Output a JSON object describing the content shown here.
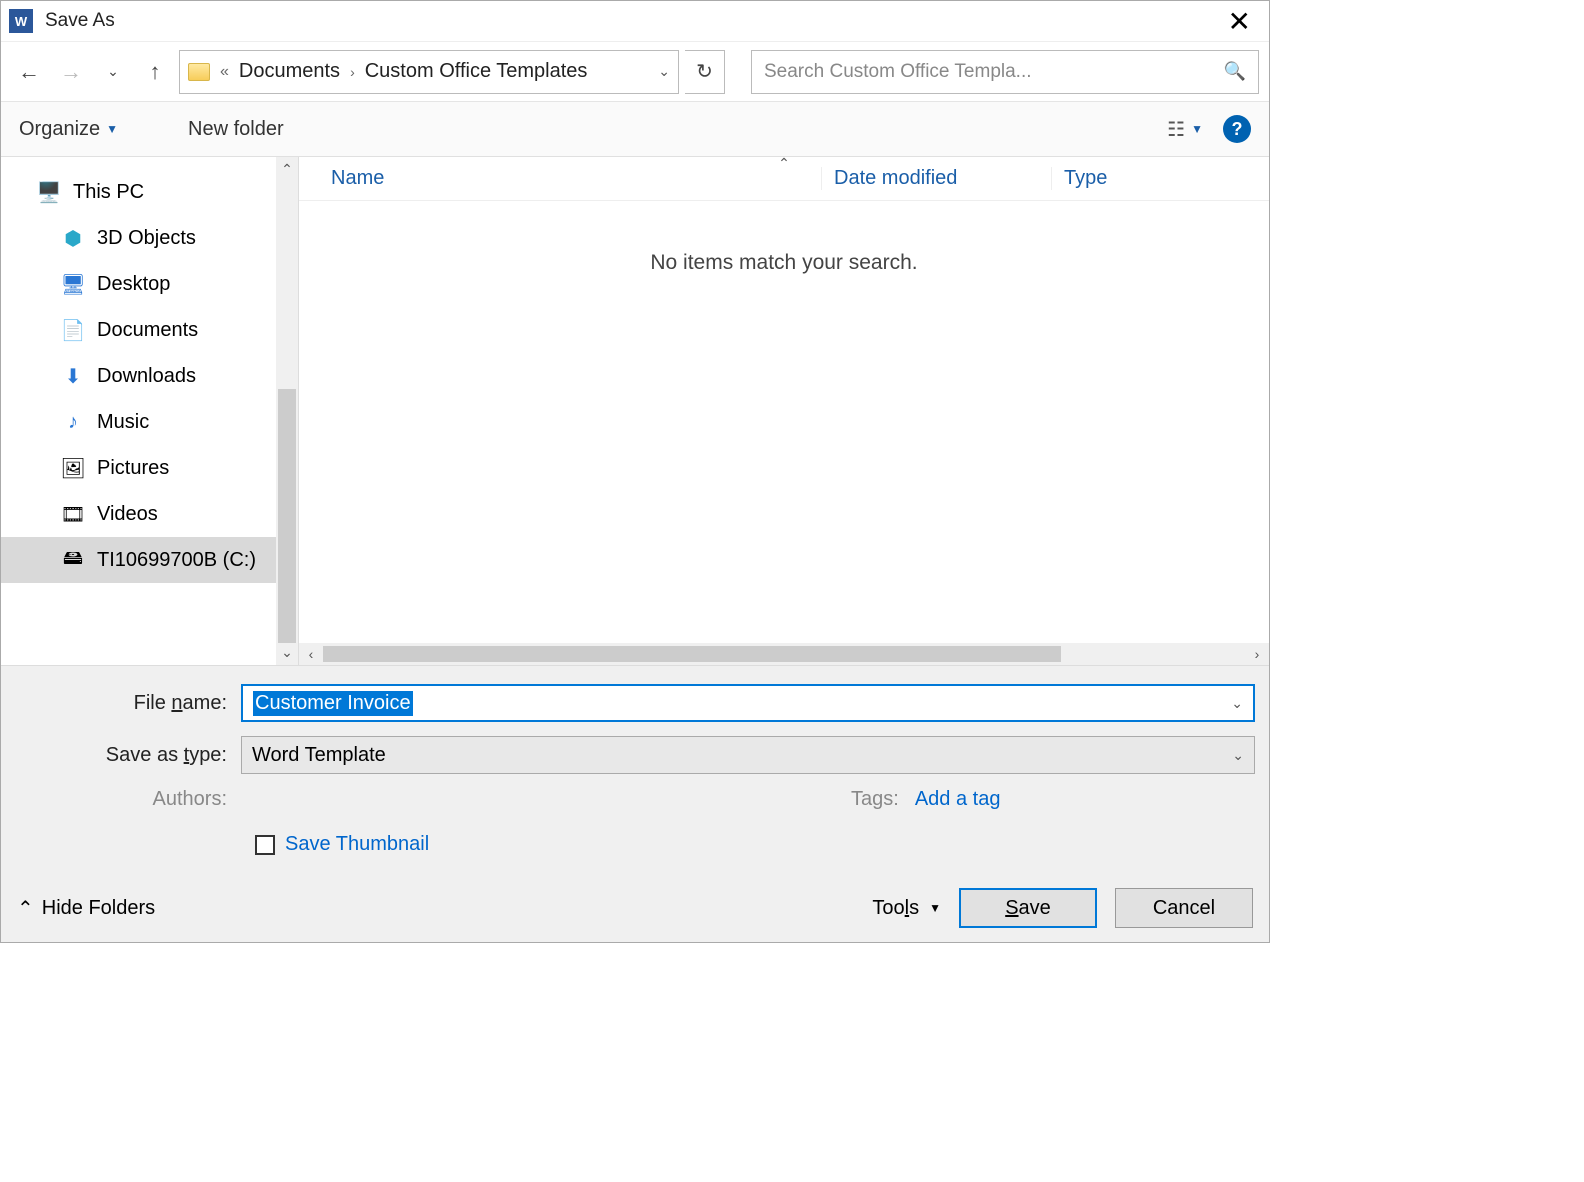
{
  "title_bar": {
    "title": "Save As",
    "app_letter": "W"
  },
  "nav": {
    "breadcrumb_prefix": "«",
    "breadcrumbs": [
      "Documents",
      "Custom Office Templates"
    ],
    "search_placeholder": "Search Custom Office Templa..."
  },
  "toolbar": {
    "organize": "Organize",
    "new_folder": "New folder"
  },
  "sidebar": {
    "root": {
      "label": "This PC"
    },
    "items": [
      {
        "icon": "cube",
        "label": "3D Objects"
      },
      {
        "icon": "monitor",
        "label": "Desktop"
      },
      {
        "icon": "doc",
        "label": "Documents"
      },
      {
        "icon": "download",
        "label": "Downloads"
      },
      {
        "icon": "music",
        "label": "Music"
      },
      {
        "icon": "pictures",
        "label": "Pictures"
      },
      {
        "icon": "videos",
        "label": "Videos"
      },
      {
        "icon": "drive",
        "label": "TI10699700B (C:)",
        "selected": true
      }
    ]
  },
  "content": {
    "columns": {
      "name": "Name",
      "date": "Date modified",
      "type": "Type"
    },
    "empty": "No items match your search."
  },
  "form": {
    "file_name_label": "File name:",
    "file_name_value": "Customer Invoice",
    "save_type_label": "Save as type:",
    "save_type_value": "Word Template",
    "authors_label": "Authors:",
    "tags_label": "Tags:",
    "add_tag": "Add a tag",
    "save_thumbnail": "Save Thumbnail"
  },
  "footer": {
    "hide_folders": "Hide Folders",
    "tools": "Tools",
    "save": "Save",
    "cancel": "Cancel"
  }
}
